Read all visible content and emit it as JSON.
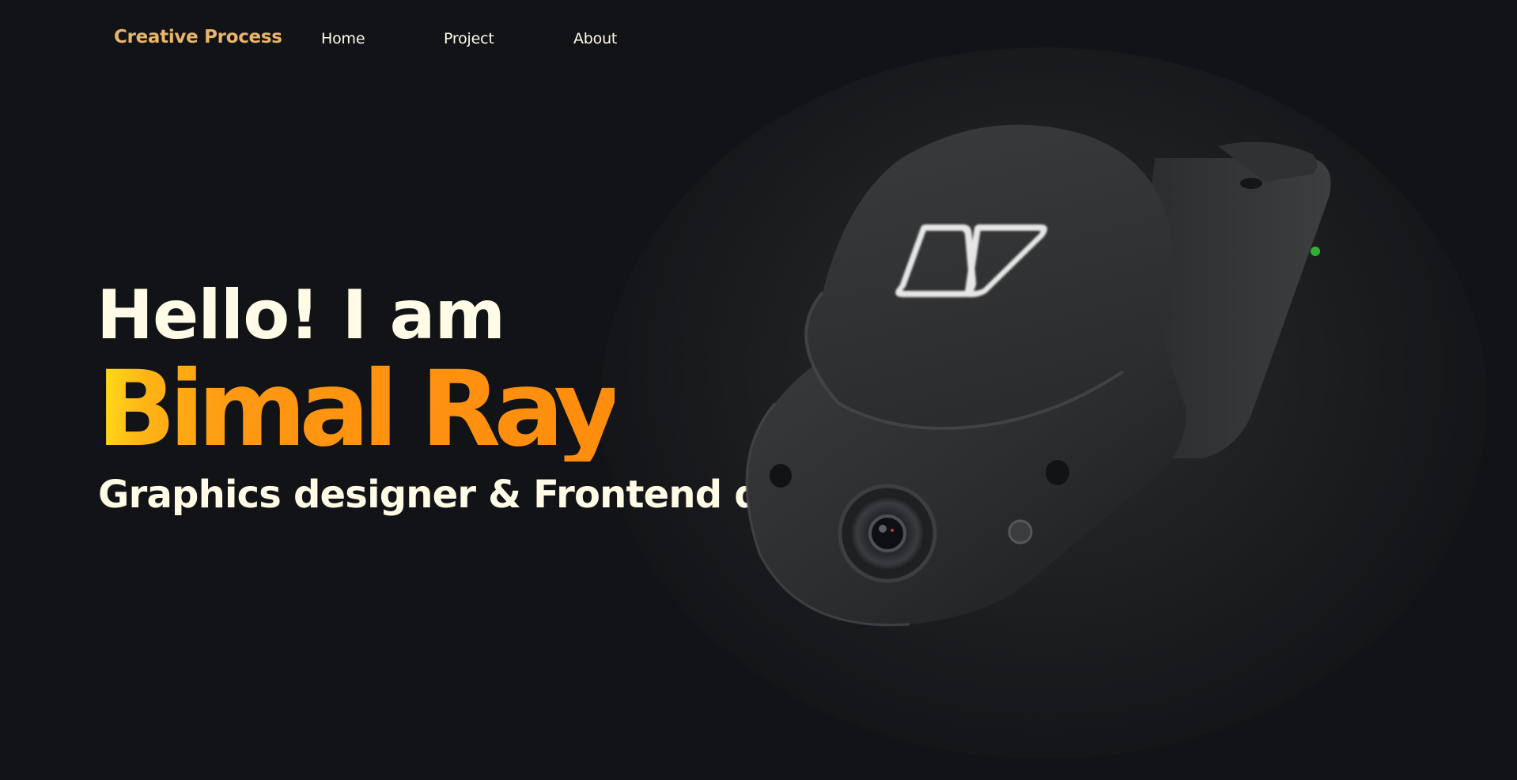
{
  "nav": {
    "brand": "Creative Process",
    "links": [
      {
        "label": "Home"
      },
      {
        "label": "Project"
      },
      {
        "label": "About"
      }
    ]
  },
  "hero": {
    "greeting": "Hello! I am",
    "name": "Bimal Ray",
    "role": "Graphics designer & Frontend devloper."
  },
  "colors": {
    "background": "#111316",
    "brand": "#e8b56a",
    "text": "#fffbe6",
    "name_gradient_start": "#ffe21a",
    "name_gradient_end": "#ff8d0e"
  },
  "image": {
    "icon": "dashcam-device-image"
  }
}
